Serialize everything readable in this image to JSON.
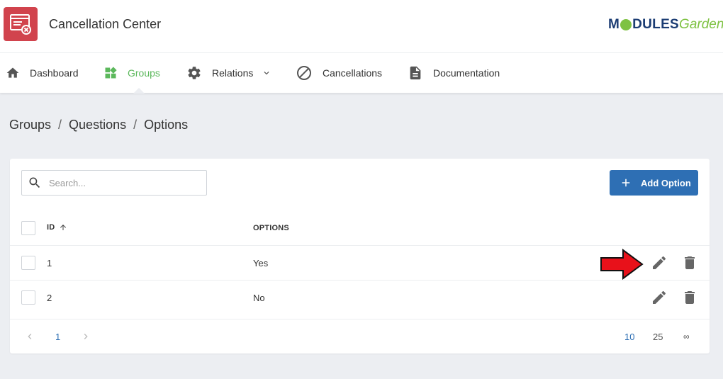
{
  "app": {
    "title": "Cancellation Center",
    "icon": "cancellation-window-icon"
  },
  "brand": {
    "part1": "M",
    "part2": "DULES",
    "part3": "Garden",
    "colors": {
      "dark": "#1b3c73",
      "green": "#7ec242"
    }
  },
  "nav": {
    "items": [
      {
        "label": "Dashboard",
        "icon": "home-icon"
      },
      {
        "label": "Groups",
        "icon": "widgets-icon",
        "active": true
      },
      {
        "label": "Relations",
        "icon": "gear-icon"
      },
      {
        "label": "Cancellations",
        "icon": "block-icon"
      },
      {
        "label": "Documentation",
        "icon": "document-icon"
      }
    ],
    "active_color": "#5cb85c"
  },
  "breadcrumb": [
    "Groups",
    "Questions",
    "Options"
  ],
  "breadcrumb_sep": "/",
  "toolbar": {
    "search_placeholder": "Search...",
    "search_value": "",
    "add_label": "Add Option",
    "accent": "#2e6fb4"
  },
  "table": {
    "columns": [
      "ID",
      "OPTIONS"
    ],
    "sort": {
      "column": "ID",
      "direction": "asc"
    },
    "rows": [
      {
        "id": "1",
        "option": "Yes"
      },
      {
        "id": "2",
        "option": "No"
      }
    ]
  },
  "pagination": {
    "current_page": "1",
    "page_sizes": [
      "10",
      "25",
      "∞"
    ],
    "active_size": "10"
  },
  "annotation": {
    "arrow_color": "#e8111a"
  }
}
